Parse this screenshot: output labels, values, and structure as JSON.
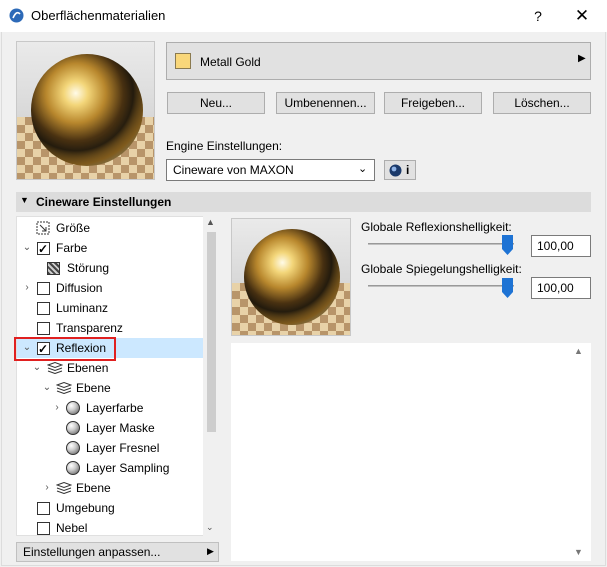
{
  "window": {
    "title": "Oberflächenmaterialien",
    "help_label": "?",
    "close_label": "✕"
  },
  "material": {
    "name": "Metall Gold",
    "swatch_color": "#f9d77a"
  },
  "buttons": {
    "new": "Neu...",
    "rename": "Umbenennen...",
    "share": "Freigeben...",
    "delete": "Löschen..."
  },
  "engine": {
    "label": "Engine Einstellungen:",
    "selected": "Cineware von MAXON",
    "info_label": "i"
  },
  "section": {
    "title": "Cineware Einstellungen"
  },
  "tree": {
    "items": [
      {
        "label": "Größe"
      },
      {
        "label": "Farbe"
      },
      {
        "label": "Störung"
      },
      {
        "label": "Diffusion"
      },
      {
        "label": "Luminanz"
      },
      {
        "label": "Transparenz"
      },
      {
        "label": "Reflexion"
      },
      {
        "label": "Ebenen"
      },
      {
        "label": "Ebene"
      },
      {
        "label": "Layerfarbe"
      },
      {
        "label": "Layer Maske"
      },
      {
        "label": "Layer Fresnel"
      },
      {
        "label": "Layer Sampling"
      },
      {
        "label": "Ebene"
      },
      {
        "label": "Umgebung"
      },
      {
        "label": "Nebel"
      }
    ],
    "adjust_label": "Einstellungen anpassen..."
  },
  "reflection": {
    "global_reflection_label": "Globale Reflexionshelligkeit:",
    "global_reflection_value": "100,00",
    "global_reflection_level": 1.0,
    "global_mirror_label": "Globale Spiegelungshelligkeit:",
    "global_mirror_value": "100,00",
    "global_mirror_level": 1.0
  },
  "colors": {
    "accent": "#1e73d4",
    "selection": "#cce8ff",
    "highlight_border": "#e02020"
  }
}
